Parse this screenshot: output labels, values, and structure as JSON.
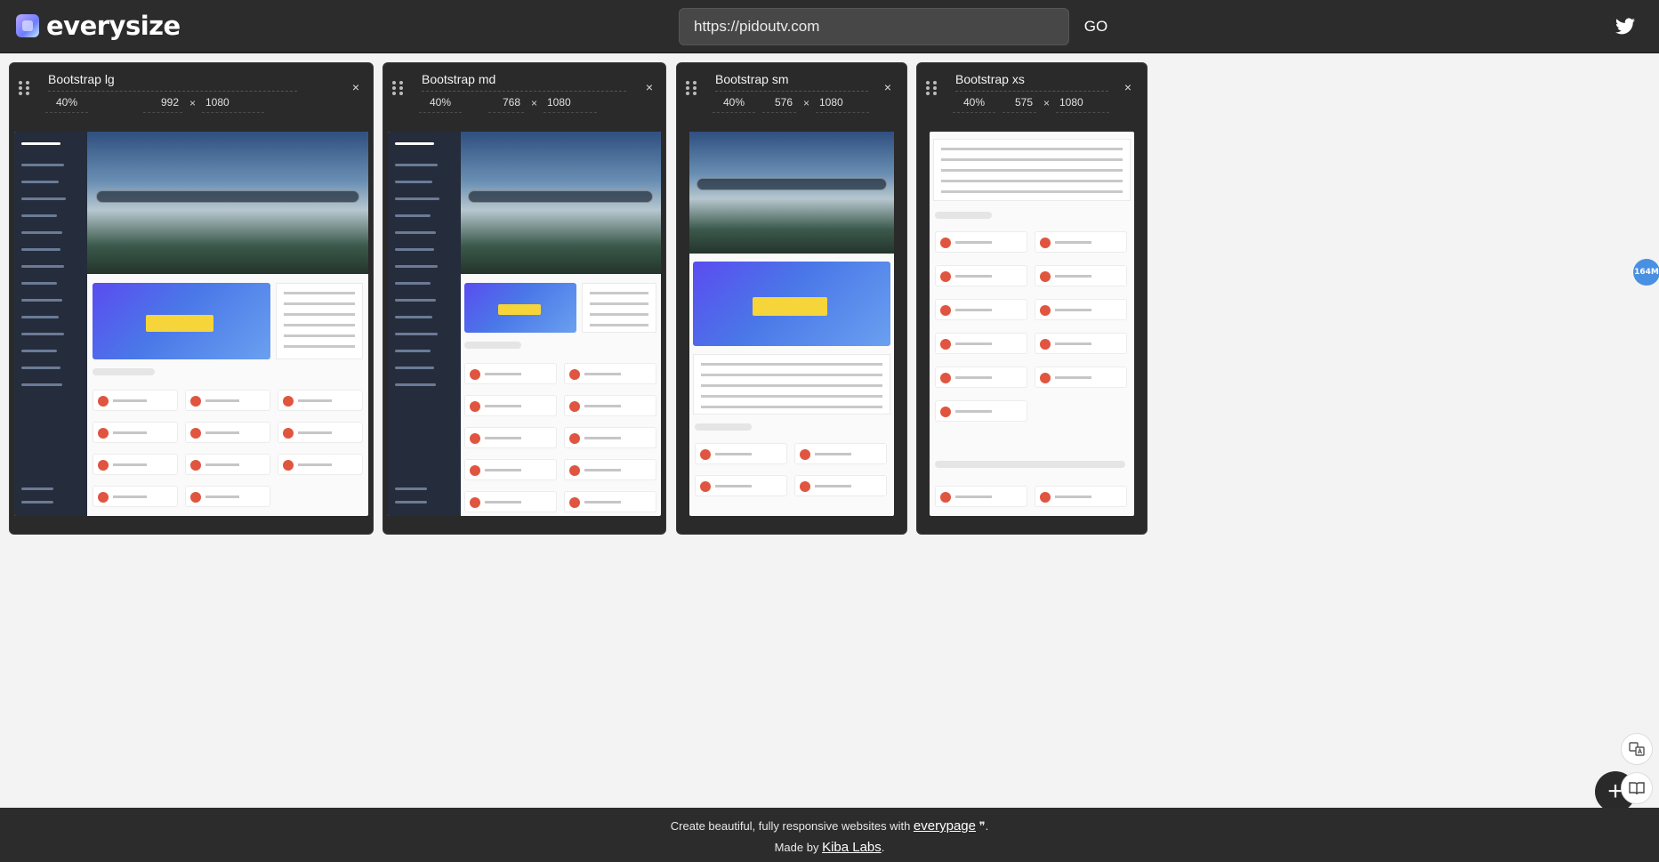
{
  "header": {
    "brand": "everysize",
    "url_value": "https://pidoutv.com",
    "go_label": "GO"
  },
  "cards": [
    {
      "title": "Bootstrap lg",
      "zoom": "40%",
      "width": "992",
      "times": "×",
      "height": "1080",
      "close": "×"
    },
    {
      "title": "Bootstrap md",
      "zoom": "40%",
      "width": "768",
      "times": "×",
      "height": "1080",
      "close": "×"
    },
    {
      "title": "Bootstrap sm",
      "zoom": "40%",
      "width": "576",
      "times": "×",
      "height": "1080",
      "close": "×"
    },
    {
      "title": "Bootstrap xs",
      "zoom": "40%",
      "width": "575",
      "times": "×",
      "height": "1080",
      "close": "×"
    }
  ],
  "float_badge": "164M",
  "footer": {
    "line1_prefix": "Create beautiful, fully responsive websites with ",
    "line1_link": "everypage",
    "line1_suffix": " ❞.",
    "line2_prefix": "Made by ",
    "line2_link": "Kiba Labs",
    "line2_suffix": "."
  },
  "colors": {
    "header_bg": "#2c2c2c",
    "page_bg": "#f3f3f3",
    "card_bg": "#2a2a2a",
    "badge": "#4a90e2"
  },
  "icons": [
    "logo-icon",
    "twitter-icon",
    "drag-handle-icon",
    "close-icon",
    "translate-icon",
    "book-icon",
    "plus-icon",
    "brain-icon"
  ]
}
